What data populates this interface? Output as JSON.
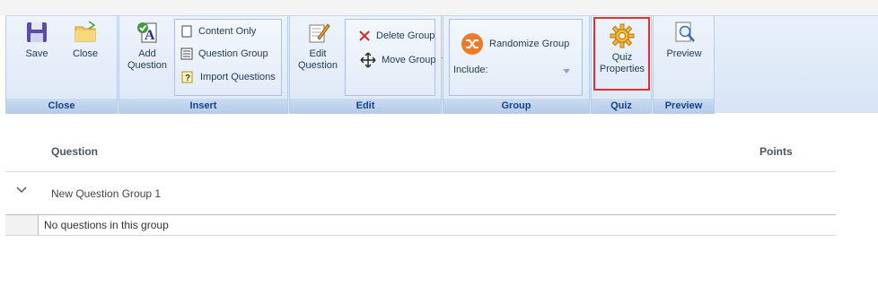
{
  "ribbon": {
    "groups": {
      "close": {
        "label": "Close",
        "save": "Save",
        "close": "Close"
      },
      "insert": {
        "label": "Insert",
        "add_question": [
          "Add",
          "Question"
        ],
        "items": [
          "Content Only",
          "Question Group",
          "Import Questions"
        ]
      },
      "edit": {
        "label": "Edit",
        "edit_question": [
          "Edit",
          "Question"
        ],
        "delete_group": "Delete Group",
        "move_group": "Move Group"
      },
      "group": {
        "label": "Group",
        "randomize": "Randomize Group",
        "include_label": "Include:",
        "include_value": ""
      },
      "quiz": {
        "label": "Quiz",
        "quiz_properties": [
          "Quiz",
          "Properties"
        ]
      },
      "preview": {
        "label": "Preview",
        "preview": "Preview"
      }
    }
  },
  "table": {
    "headers": {
      "question": "Question",
      "points": "Points"
    },
    "groups": [
      {
        "name": "New Question Group 1",
        "empty_text": "No questions in this group"
      }
    ]
  },
  "colors": {
    "accent": "#15428b",
    "highlight": "#e03030",
    "randomize": "#f07a2a"
  },
  "icons": [
    "save-icon",
    "folder-icon",
    "add-question-icon",
    "document-icon",
    "list-icon",
    "import-icon",
    "edit-icon",
    "delete-icon",
    "move-icon",
    "shuffle-icon",
    "gear-icon",
    "preview-icon",
    "chevron-down-icon"
  ]
}
